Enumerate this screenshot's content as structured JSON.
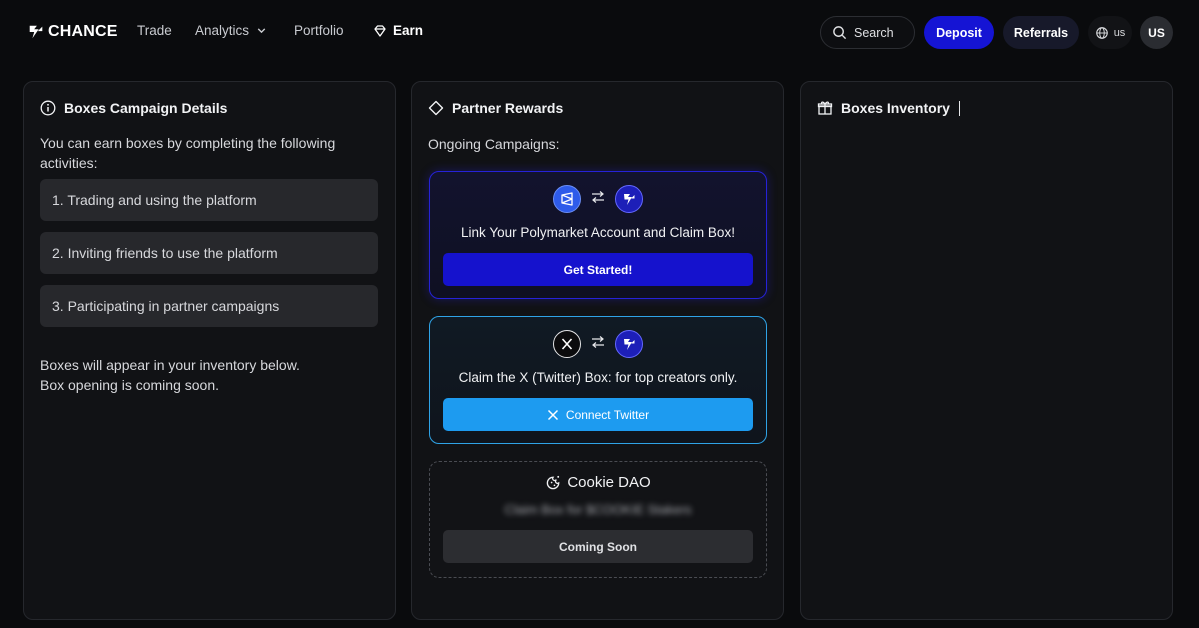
{
  "nav": {
    "logo_text": "CHANCE",
    "links": [
      {
        "label": "Trade"
      },
      {
        "label": "Analytics"
      },
      {
        "label": "Portfolio"
      },
      {
        "label": "Earn"
      }
    ],
    "search_label": "Search",
    "deposit_label": "Deposit",
    "referrals_label": "Referrals",
    "lang_label": "us",
    "avatar_initials": "US"
  },
  "campaign_details": {
    "title": "Boxes Campaign Details",
    "intro": "You can earn boxes by completing the following activities:",
    "activities": [
      "1. Trading and using the platform",
      "2. Inviting friends to use the platform",
      "3. Participating in partner campaigns"
    ],
    "footnote_line1": "Boxes will appear in your inventory below.",
    "footnote_line2": "Box opening is coming soon."
  },
  "partner_rewards": {
    "title": "Partner Rewards",
    "subtitle": "Ongoing Campaigns:",
    "campaigns": [
      {
        "text": "Link Your Polymarket Account and Claim Box!",
        "button": "Get Started!"
      },
      {
        "text": "Claim the X (Twitter) Box: for top creators only.",
        "button": "Connect Twitter"
      },
      {
        "brand": "Cookie DAO",
        "text": "Claim Box for $COOKIE Stakers",
        "button": "Coming Soon"
      }
    ]
  },
  "inventory": {
    "title": "Boxes Inventory"
  },
  "icons": {
    "info": "info-icon",
    "partner": "diamond-icon",
    "inventory": "gift-icon",
    "search": "search-icon",
    "globe": "globe-icon",
    "swap": "swap-arrows-icon"
  },
  "colors": {
    "background": "#0a0b0d",
    "panel": "#111215",
    "primary": "#1514d4",
    "twitter": "#1d9bf0"
  }
}
